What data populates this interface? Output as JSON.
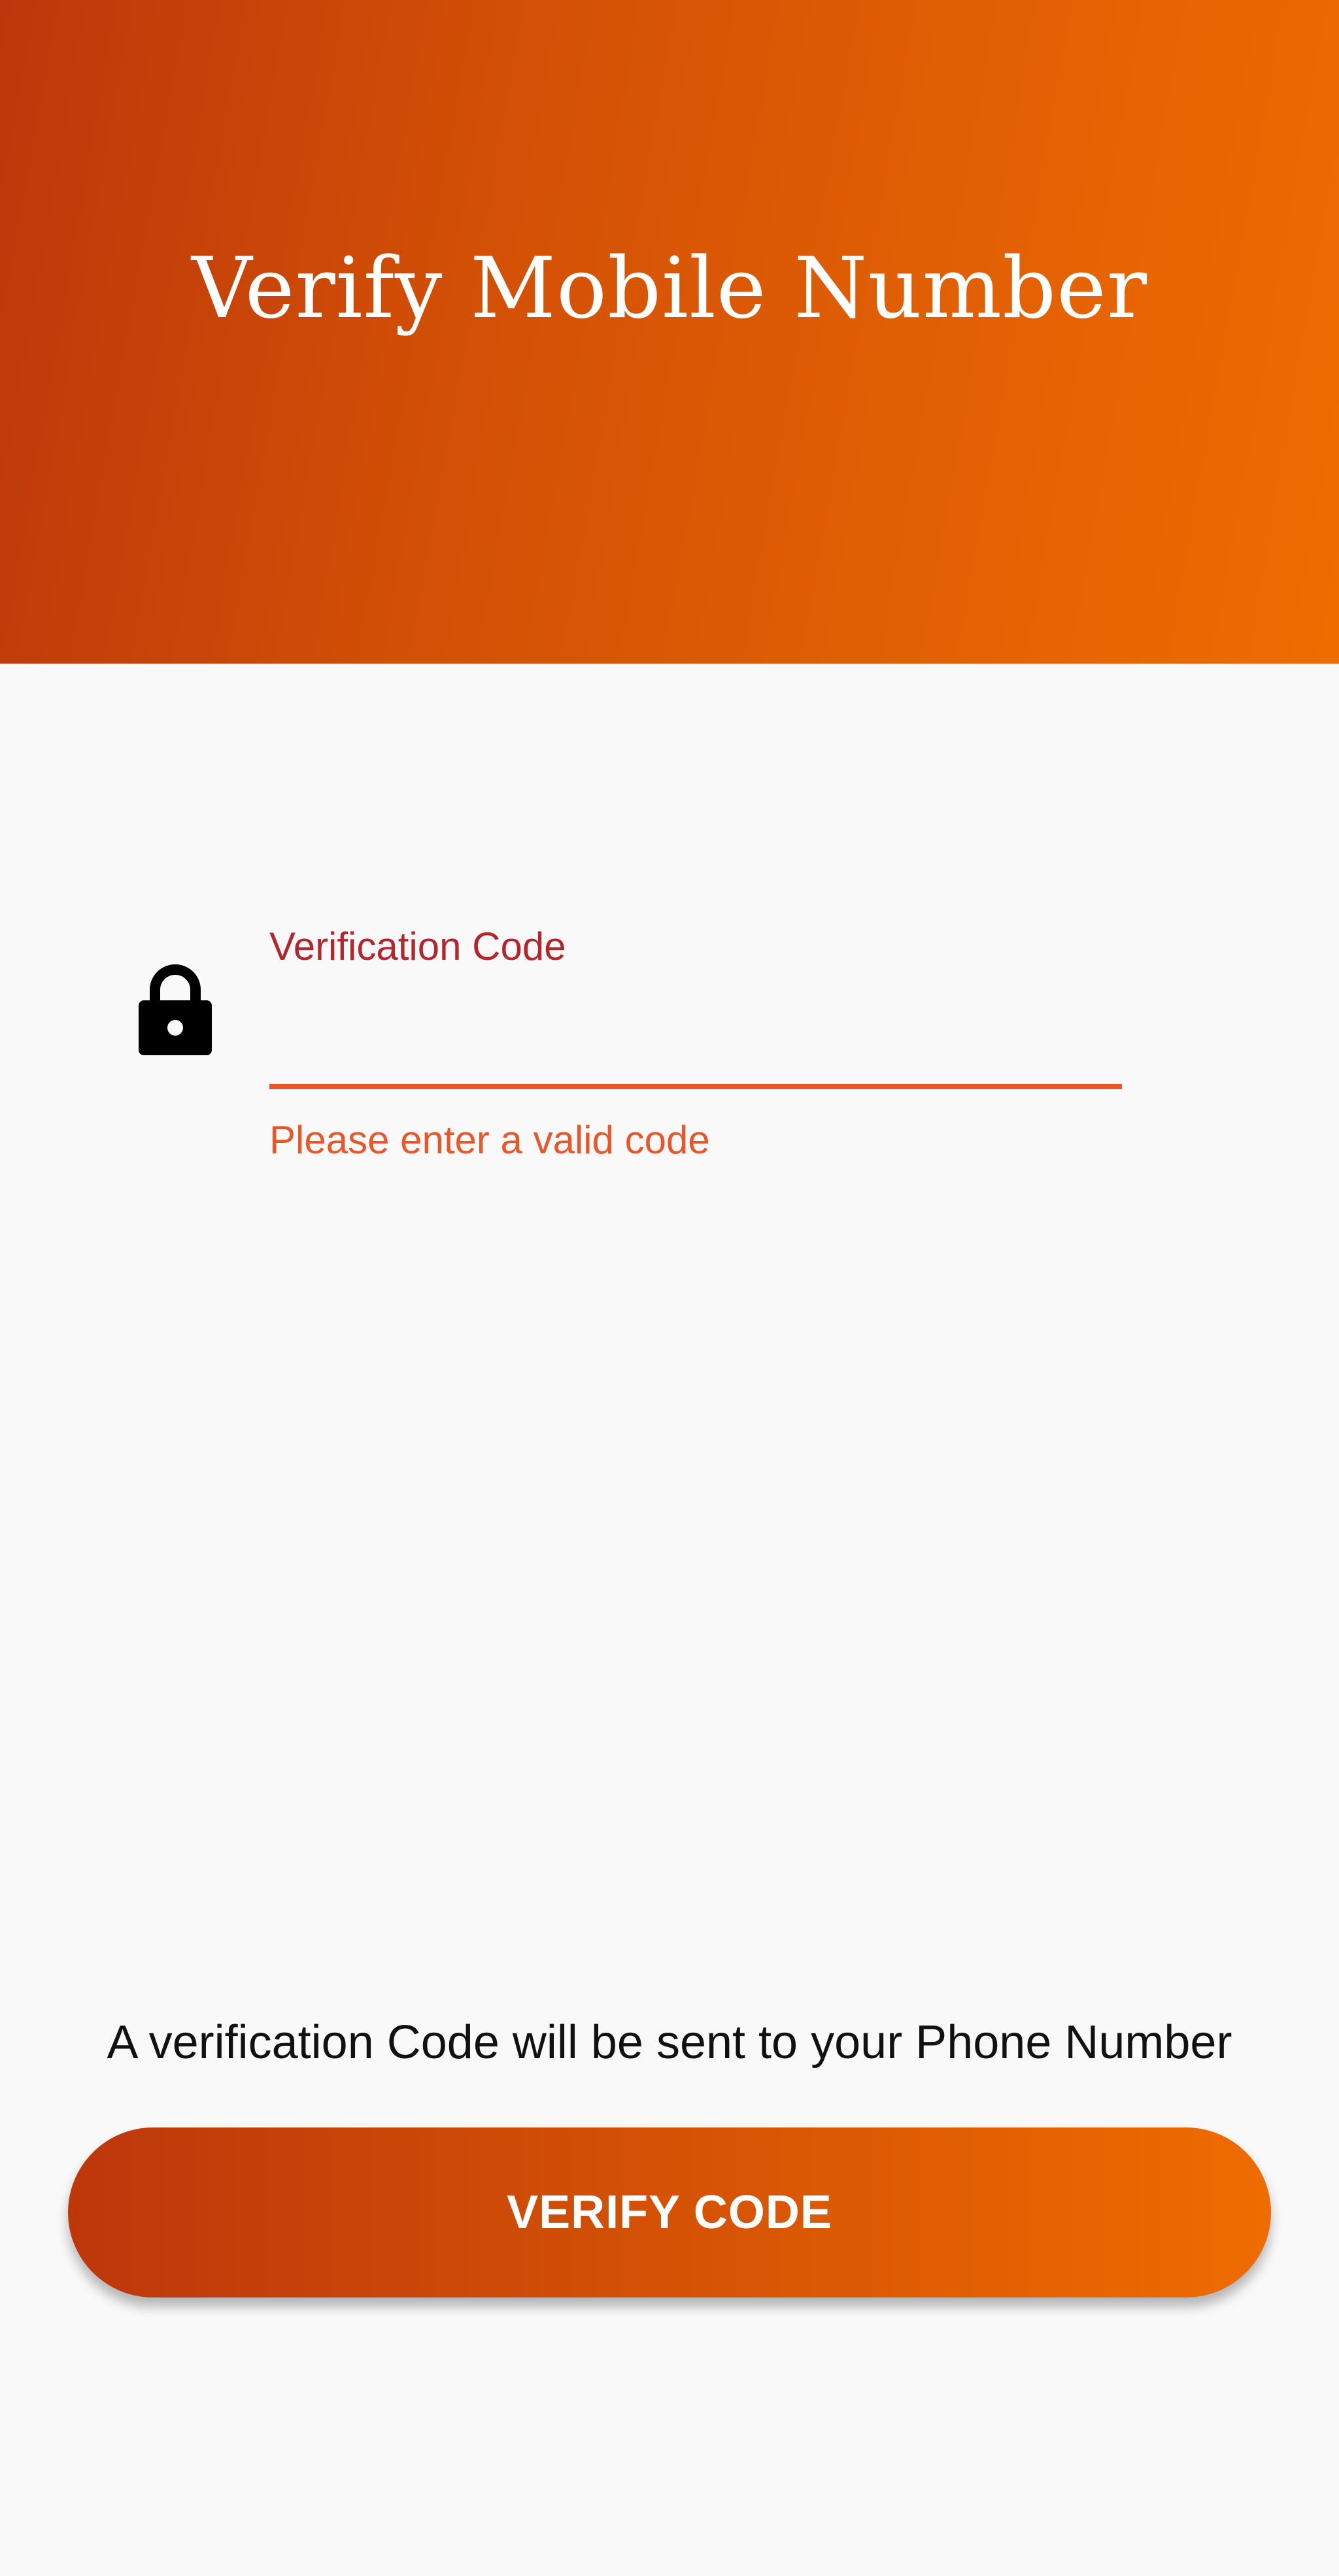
{
  "header": {
    "title": "Verify Mobile Number"
  },
  "form": {
    "code_field": {
      "icon": "lock-icon",
      "label": "Verification Code",
      "value": "",
      "placeholder": "",
      "error": "Please enter a valid code"
    }
  },
  "footer": {
    "info_text": "A verification Code will be sent to your Phone Number",
    "verify_button_label": "VERIFY CODE"
  },
  "colors": {
    "gradient_start": "#bd370c",
    "gradient_end": "#ee6c00",
    "label_color": "#b3262d",
    "error_color": "#e9562a",
    "background": "#f9f9f9"
  }
}
